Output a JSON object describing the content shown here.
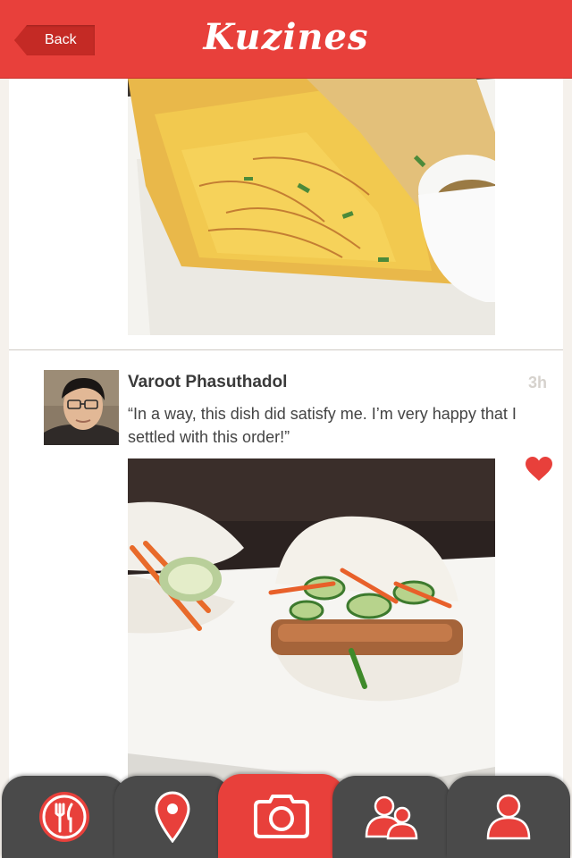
{
  "header": {
    "back_label": "Back",
    "title": "Kuzines"
  },
  "post": {
    "author": "Varoot Phasuthadol",
    "time": "3h",
    "comment": "“In a way, this dish did satisfy me. I’m very happy that I settled with this order!”",
    "liked": true
  },
  "tabbar": {
    "tabs": [
      {
        "icon": "dining-icon",
        "active": false
      },
      {
        "icon": "location-pin-icon",
        "active": false
      },
      {
        "icon": "camera-icon",
        "active": true
      },
      {
        "icon": "friends-icon",
        "active": false
      },
      {
        "icon": "profile-icon",
        "active": false
      }
    ]
  },
  "colors": {
    "brand_red": "#e8403b",
    "tab_gray": "#4a4a4a",
    "background": "#f5f1ec"
  }
}
